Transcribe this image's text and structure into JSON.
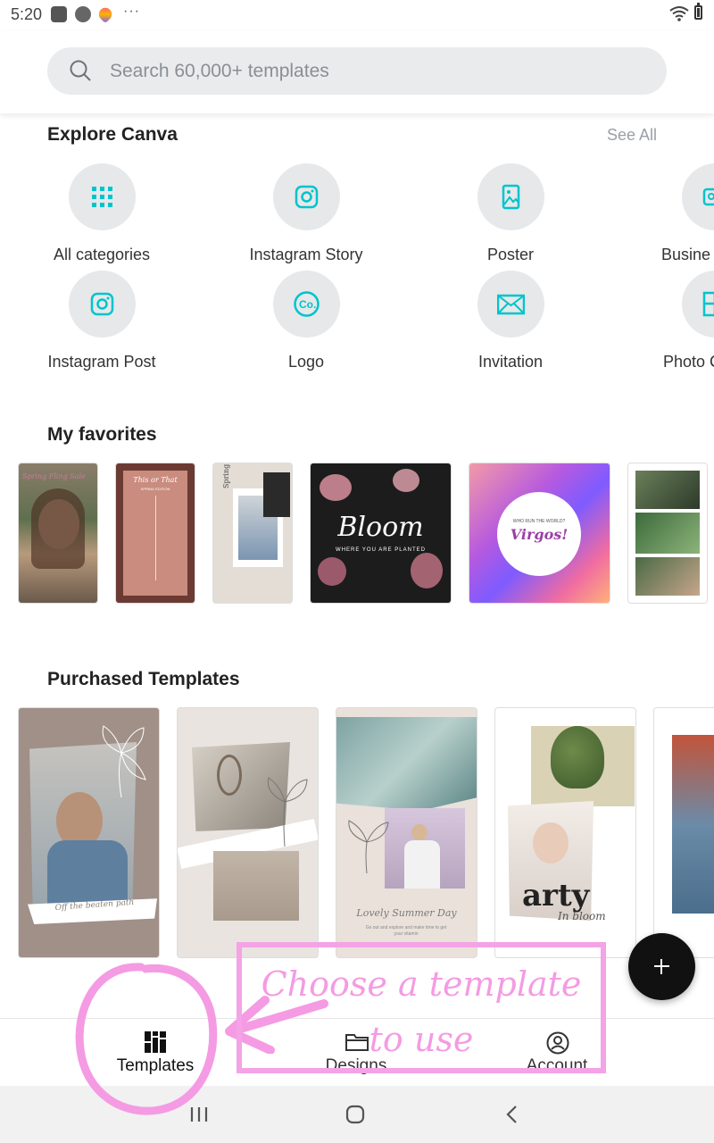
{
  "status_bar": {
    "time": "5:20",
    "more": "···"
  },
  "search": {
    "placeholder": "Search 60,000+ templates",
    "value": ""
  },
  "explore": {
    "title": "Explore Canva",
    "see_all": "See All",
    "categories": [
      {
        "label": "All categories",
        "icon": "grid-icon"
      },
      {
        "label": "Instagram Story",
        "icon": "instagram-icon"
      },
      {
        "label": "Poster",
        "icon": "poster-icon"
      },
      {
        "label": "Busine",
        "icon": "business-icon"
      },
      {
        "label": "Instagram Post",
        "icon": "instagram-icon"
      },
      {
        "label": "Logo",
        "icon": "logo-icon"
      },
      {
        "label": "Invitation",
        "icon": "envelope-icon"
      },
      {
        "label": "Photo C",
        "icon": "photo-collage-icon"
      }
    ]
  },
  "favorites": {
    "title": "My favorites",
    "items": [
      {
        "text": "Spring Fling Sale"
      },
      {
        "text": "This or That",
        "sub": "SPRING EDITION"
      },
      {
        "text": "Spring"
      },
      {
        "text": "Bloom",
        "sub": "WHERE YOU ARE PLANTED"
      },
      {
        "text": "Virgos!",
        "sub": "WHO RUN THE WORLD?"
      },
      {
        "text": ""
      }
    ]
  },
  "purchased": {
    "title": "Purchased Templates",
    "items": [
      {
        "text": "Off the beaten path"
      },
      {
        "text": ""
      },
      {
        "text": "Lovely Summer Day",
        "sub": "Go out and explore and make time to get your vitamin"
      },
      {
        "text": "arty",
        "sub": "In bloom"
      },
      {
        "text": ""
      }
    ]
  },
  "bottom_nav": {
    "templates": "Templates",
    "designs": "Designs",
    "account": "Account"
  },
  "annotation": {
    "text": "Choose a template to use"
  },
  "colors": {
    "accent": "#00c4cc",
    "annotation": "#f4a3e6",
    "fab": "#111111"
  }
}
